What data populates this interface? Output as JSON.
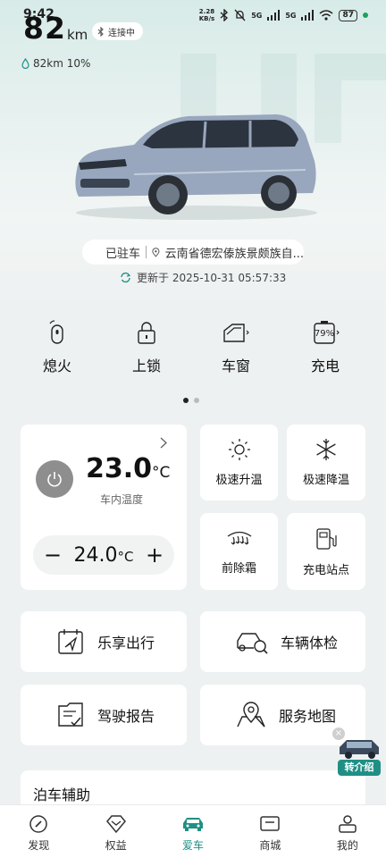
{
  "status_bar": {
    "time": "9:42",
    "net_speed_value": "2.28",
    "net_speed_unit": "KB/s",
    "signal1": "5G",
    "signal2": "5G",
    "battery": "87"
  },
  "vehicle": {
    "range_value": "82",
    "range_unit": "km",
    "connection": "连接中",
    "sub_range": "82km 10%",
    "parked": "已驻车",
    "location": "云南省德宏傣族景颇族自...",
    "updated": "更新于 2025-10-31 05:57:33"
  },
  "quick_actions": [
    {
      "label": "熄火",
      "icon": "key-fob-icon"
    },
    {
      "label": "上锁",
      "icon": "lock-icon"
    },
    {
      "label": "车窗",
      "icon": "window-icon"
    },
    {
      "label": "充电",
      "icon": "battery-charge-icon",
      "badge": "79%"
    }
  ],
  "pager": {
    "count": 2,
    "active": 0
  },
  "climate": {
    "current_temp": "23.0",
    "unit": "°C",
    "label": "车内温度",
    "set_temp": "24.0",
    "minus": "−",
    "plus": "+"
  },
  "tiles": [
    {
      "label": "极速升温",
      "icon": "sun-icon"
    },
    {
      "label": "极速降温",
      "icon": "snowflake-icon"
    },
    {
      "label": "前除霜",
      "icon": "defrost-icon"
    },
    {
      "label": "充电站点",
      "icon": "charging-station-icon"
    }
  ],
  "wide_cards": [
    {
      "label": "乐享出行",
      "icon": "navigation-calendar-icon"
    },
    {
      "label": "车辆体检",
      "icon": "car-check-icon"
    },
    {
      "label": "驾驶报告",
      "icon": "report-icon"
    },
    {
      "label": "服务地图",
      "icon": "map-pin-icon"
    }
  ],
  "parking": {
    "label": "泊车辅助"
  },
  "promo": {
    "label": "转介绍"
  },
  "tabs": [
    {
      "label": "发现",
      "icon": "compass-icon",
      "active": false
    },
    {
      "label": "权益",
      "icon": "gem-icon",
      "active": false
    },
    {
      "label": "爱车",
      "icon": "car-icon",
      "active": true
    },
    {
      "label": "商城",
      "icon": "store-icon",
      "active": false
    },
    {
      "label": "我的",
      "icon": "profile-icon",
      "active": false
    }
  ],
  "colors": {
    "accent": "#1f8f86",
    "card": "#ffffff",
    "bg": "#eef1f1"
  }
}
